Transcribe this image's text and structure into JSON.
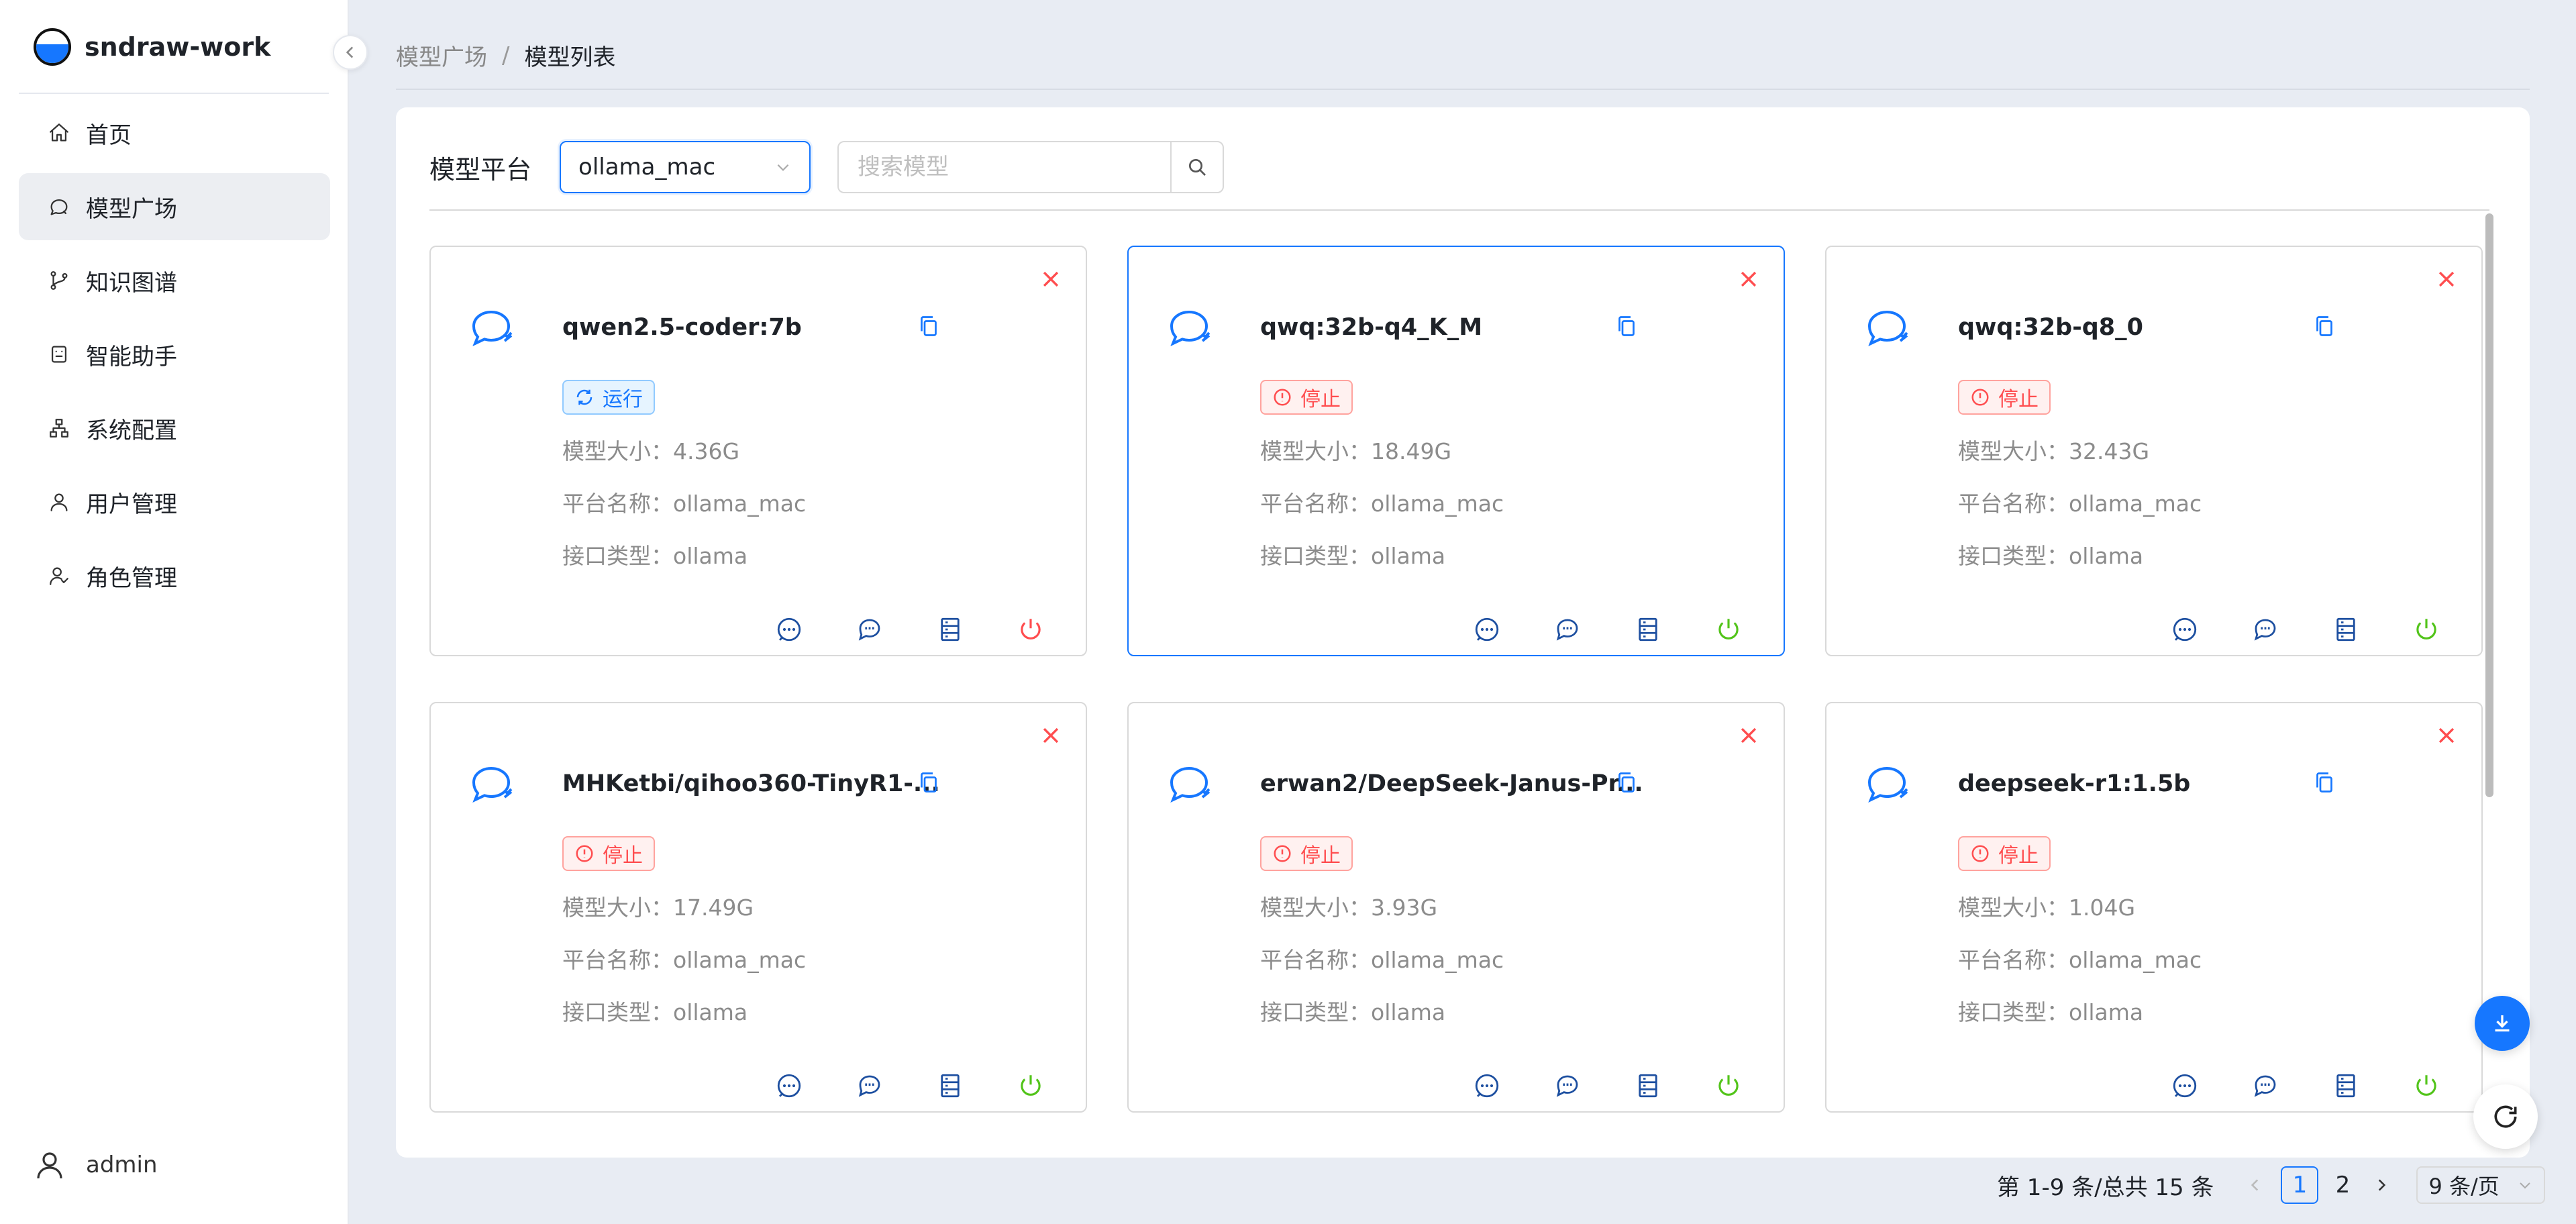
{
  "app": {
    "name": "sndraw-work"
  },
  "sidebar": {
    "items": [
      {
        "label": "首页",
        "icon": "home-icon",
        "active": false
      },
      {
        "label": "模型广场",
        "icon": "chat-bubble-icon",
        "active": true
      },
      {
        "label": "知识图谱",
        "icon": "branch-icon",
        "active": false
      },
      {
        "label": "智能助手",
        "icon": "robot-icon",
        "active": false
      },
      {
        "label": "系统配置",
        "icon": "sitemap-icon",
        "active": false
      },
      {
        "label": "用户管理",
        "icon": "user-icon",
        "active": false
      },
      {
        "label": "角色管理",
        "icon": "users-icon",
        "active": false
      }
    ],
    "user": "admin"
  },
  "breadcrumb": {
    "parent": "模型广场",
    "separator": "/",
    "current": "模型列表"
  },
  "filter": {
    "label": "模型平台",
    "platform_value": "ollama_mac",
    "search_placeholder": "搜索模型"
  },
  "labels": {
    "size": "模型大小：",
    "platform": "平台名称：",
    "api": "接口类型："
  },
  "cards": [
    {
      "name": "qwen2.5-coder:7b",
      "status": "运行",
      "status_type": "run",
      "size": "4.36G",
      "platform": "ollama_mac",
      "api": "ollama",
      "selected": false
    },
    {
      "name": "qwq:32b-q4_K_M",
      "status": "停止",
      "status_type": "stop",
      "size": "18.49G",
      "platform": "ollama_mac",
      "api": "ollama",
      "selected": true
    },
    {
      "name": "qwq:32b-q8_0",
      "status": "停止",
      "status_type": "stop",
      "size": "32.43G",
      "platform": "ollama_mac",
      "api": "ollama",
      "selected": false
    },
    {
      "name": "MHKetbi/qihoo360-TinyR1-...",
      "status": "停止",
      "status_type": "stop",
      "size": "17.49G",
      "platform": "ollama_mac",
      "api": "ollama",
      "selected": false
    },
    {
      "name": "erwan2/DeepSeek-Janus-Pr...",
      "status": "停止",
      "status_type": "stop",
      "size": "3.93G",
      "platform": "ollama_mac",
      "api": "ollama",
      "selected": false
    },
    {
      "name": "deepseek-r1:1.5b",
      "status": "停止",
      "status_type": "stop",
      "size": "1.04G",
      "platform": "ollama_mac",
      "api": "ollama",
      "selected": false
    }
  ],
  "pagination": {
    "total_text": "第 1-9 条/总共 15 条",
    "pages": [
      "1",
      "2"
    ],
    "current": "1",
    "page_size": "9 条/页"
  },
  "colors": {
    "primary": "#1677ff",
    "danger": "#ff4d4f",
    "success": "#52c41a",
    "icon_dark": "#1d4fa0"
  }
}
